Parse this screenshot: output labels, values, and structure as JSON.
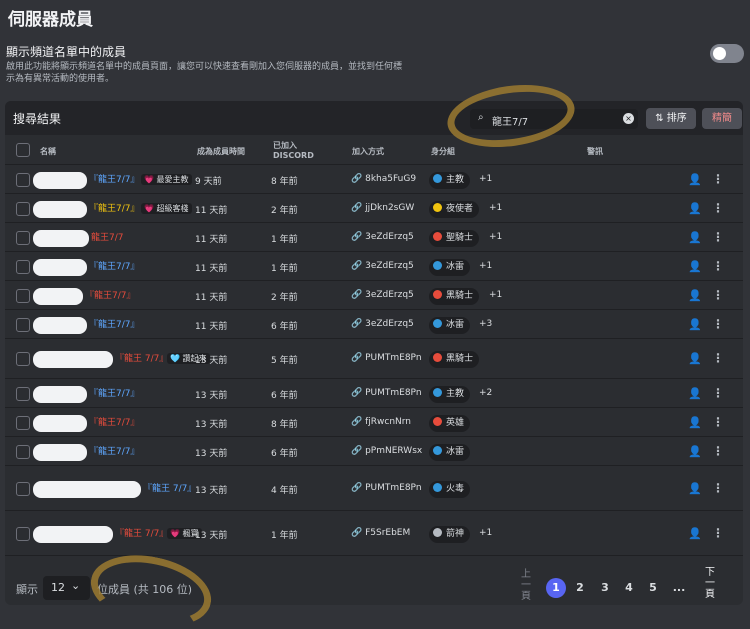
{
  "page": {
    "title": "伺服器成員",
    "setting_title": "顯示頻道名單中的成員",
    "setting_desc": "啟用此功能將顯示頻道名單中的成員頁面，讓您可以快速查看剛加入您伺服器的成員，並找到任何標示為有異常活動的使用者。",
    "toggle_on": false
  },
  "panel": {
    "title": "搜尋結果",
    "search_value": "龍王7/7",
    "sort_label": "排序",
    "prune_label": "精簡"
  },
  "columns": {
    "name": "名稱",
    "member_since": "成為成員時間",
    "joined_discord_1": "已加入",
    "joined_discord_2": "DISCORD",
    "join_method": "加入方式",
    "roles": "身分組",
    "signals": "警訊"
  },
  "rows": [
    {
      "nick": "『龍王7/7』",
      "nick_color": "#5ea7ff",
      "badge": "💗 最愛主教",
      "member_since": "9 天前",
      "joined": "8 年前",
      "invite": "8kha5FuG9",
      "role": "主教",
      "role_color": "#3498db",
      "extra": "+1"
    },
    {
      "nick": "『龍王7/7』",
      "nick_color": "#f1c40f",
      "badge": "💗 超級客棧",
      "member_since": "11 天前",
      "joined": "2 年前",
      "invite": "jjDkn2sGW",
      "role": "夜使者",
      "role_color": "#f1c40f",
      "extra": "+1"
    },
    {
      "nick": "龍王7/7",
      "nick_color": "#e74c3c",
      "badge": "",
      "member_since": "11 天前",
      "joined": "1 年前",
      "invite": "3eZdErzq5",
      "role": "聖騎士",
      "role_color": "#e74c3c",
      "extra": "+1"
    },
    {
      "nick": "『龍王7/7』",
      "nick_color": "#5ea7ff",
      "badge": "",
      "member_since": "11 天前",
      "joined": "1 年前",
      "invite": "3eZdErzq5",
      "role": "冰雷",
      "role_color": "#3498db",
      "extra": "+1"
    },
    {
      "nick": "『龍王7/7』",
      "nick_color": "#e74c3c",
      "badge": "",
      "member_since": "11 天前",
      "joined": "2 年前",
      "invite": "3eZdErzq5",
      "role": "黑騎士",
      "role_color": "#e74c3c",
      "extra": "+1"
    },
    {
      "nick": "『龍王7/7』",
      "nick_color": "#5ea7ff",
      "badge": "",
      "member_since": "11 天前",
      "joined": "6 年前",
      "invite": "3eZdErzq5",
      "role": "冰雷",
      "role_color": "#3498db",
      "extra": "+3"
    },
    {
      "nick": "『龍王 7/7』",
      "nick_color": "#e74c3c",
      "badge": "🩵 讚起來",
      "member_since": "13 天前",
      "joined": "5 年前",
      "invite": "PUMTmE8Pn",
      "role": "黑騎士",
      "role_color": "#e74c3c",
      "extra": ""
    },
    {
      "nick": "『龍王7/7』",
      "nick_color": "#5ea7ff",
      "badge": "",
      "member_since": "13 天前",
      "joined": "6 年前",
      "invite": "PUMTmE8Pn",
      "role": "主教",
      "role_color": "#3498db",
      "extra": "+2"
    },
    {
      "nick": "『龍王7/7』",
      "nick_color": "#e74c3c",
      "badge": "",
      "member_since": "13 天前",
      "joined": "8 年前",
      "invite": "fjRwcnNrn",
      "role": "英雄",
      "role_color": "#e74c3c",
      "extra": ""
    },
    {
      "nick": "『龍王7/7』",
      "nick_color": "#5ea7ff",
      "badge": "",
      "member_since": "13 天前",
      "joined": "6 年前",
      "invite": "pPmNERWsx",
      "role": "冰雷",
      "role_color": "#3498db",
      "extra": ""
    },
    {
      "nick": "『龍王 7/7』",
      "nick_color": "#5ea7ff",
      "badge": "",
      "member_since": "13 天前",
      "joined": "4 年前",
      "invite": "PUMTmE8Pn",
      "role": "火毒",
      "role_color": "#3498db",
      "extra": ""
    },
    {
      "nick": "『龍王 7/7』",
      "nick_color": "#e74c3c",
      "badge": "💗 楓寶",
      "member_since": "13 天前",
      "joined": "1 年前",
      "invite": "F5SrEbEM",
      "role": "箭神",
      "role_color": "#b5bac1",
      "extra": "+1"
    }
  ],
  "footer": {
    "show_label": "顯示",
    "page_size": "12",
    "count_text": "位成員 (共 106 位)",
    "prev": [
      "上",
      "一",
      "頁"
    ],
    "pages": [
      "1",
      "2",
      "3",
      "4",
      "5",
      "..."
    ],
    "next": [
      "下",
      "一",
      "頁"
    ]
  },
  "colors": {
    "accent": "#5865f2",
    "background": "#313338",
    "panel": "#2b2d31"
  }
}
